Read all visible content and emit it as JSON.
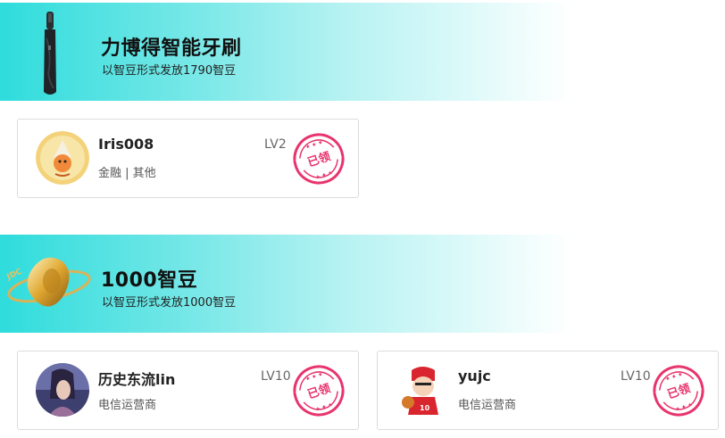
{
  "sections": [
    {
      "title": "力博得智能牙刷",
      "subtitle": "以智豆形式发放1790智豆",
      "thumbnail_icon": "toothbrush-icon",
      "winners": [
        {
          "name": "Iris008",
          "dept": "金融 | 其他",
          "level": "LV2",
          "stamp": "已领"
        }
      ]
    },
    {
      "title": "1000智豆",
      "subtitle": "以智豆形式发放1000智豆",
      "thumbnail_icon": "gold-bean-icon",
      "winners": [
        {
          "name": "历史东流lin",
          "dept": "电信运营商",
          "level": "LV10",
          "stamp": "已领"
        },
        {
          "name": "yujc",
          "dept": "电信运营商",
          "level": "LV10",
          "stamp": "已领"
        }
      ]
    }
  ],
  "colors": {
    "banner_start": "#2fdcdc",
    "stamp": "#e8336d",
    "border": "#dcdcdc"
  }
}
